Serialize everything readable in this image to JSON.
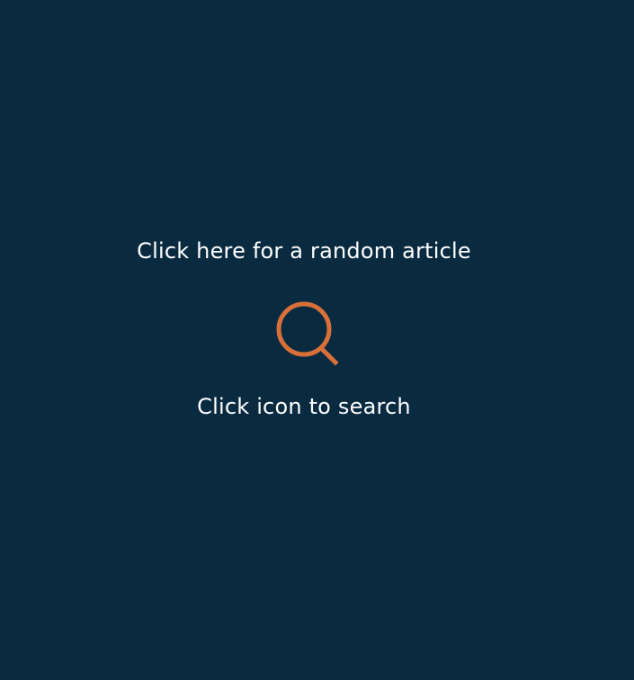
{
  "random_article": {
    "label": "Click here for a random article"
  },
  "search": {
    "icon": "search-icon",
    "caption": "Click icon to search"
  },
  "colors": {
    "background": "#0a2a40",
    "text": "#ffffff",
    "accent": "#d9703a"
  }
}
